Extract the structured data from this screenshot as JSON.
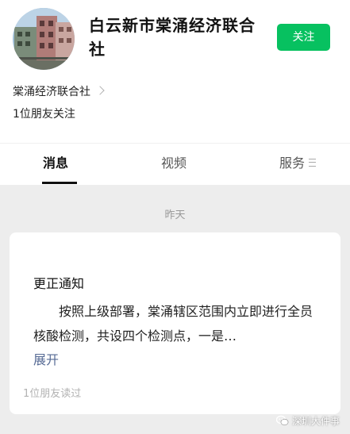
{
  "header": {
    "account_name": "白云新市棠涌经济联合社",
    "follow_label": "关注",
    "entity_name": "棠涌经济联合社",
    "friends_follow": "1位朋友关注"
  },
  "tabs": [
    {
      "label": "消息",
      "active": true
    },
    {
      "label": "视频",
      "active": false
    },
    {
      "label": "服务",
      "active": false
    }
  ],
  "feed": {
    "date_label": "昨天",
    "message": {
      "title": "更正通知",
      "body": "按照上级部署，棠涌辖区范围内立即进行全员核酸检测，共设四个检测点，一是…",
      "expand_label": "展开",
      "read_count": "1位朋友读过"
    }
  },
  "watermark": {
    "text": "深圳大件事"
  },
  "colors": {
    "accent_green": "#07c160",
    "link_blue": "#576b95",
    "page_background": "#ededed"
  },
  "icons": {
    "chevron": "chevron-right-icon",
    "tab_menu": "menu-icon",
    "watermark": "wechat-icon"
  }
}
